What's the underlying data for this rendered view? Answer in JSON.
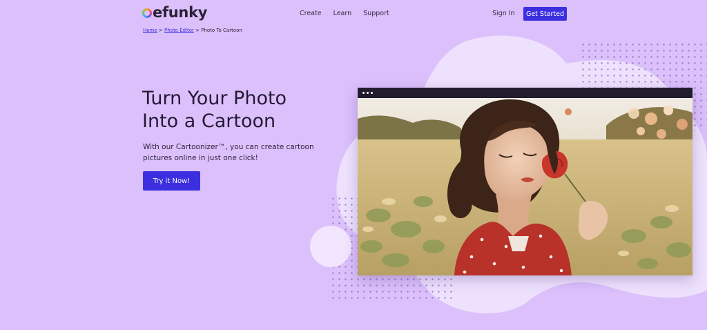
{
  "header": {
    "logo_b": "",
    "logo_text": "efunky",
    "nav": [
      "Create",
      "Learn",
      "Support"
    ],
    "sign_in": "Sign In",
    "get_started": "Get Started"
  },
  "breadcrumb": {
    "home": "Home",
    "sep1": " > ",
    "photo_editor": "Photo Editor",
    "sep2": " > ",
    "current": "Photo To Cartoon"
  },
  "hero": {
    "title_line1": "Turn Your Photo",
    "title_line2": "Into a Cartoon",
    "subtitle_line1": "With our Cartoonizer™, you can create cartoon",
    "subtitle_line2": "pictures online in just one click!",
    "cta": "Try it Now!"
  },
  "colors": {
    "background": "#dcc0fb",
    "accent": "#3c2fe0",
    "blob": "#ede1fd"
  },
  "icons": {
    "window_menu": "three-dots-icon"
  }
}
